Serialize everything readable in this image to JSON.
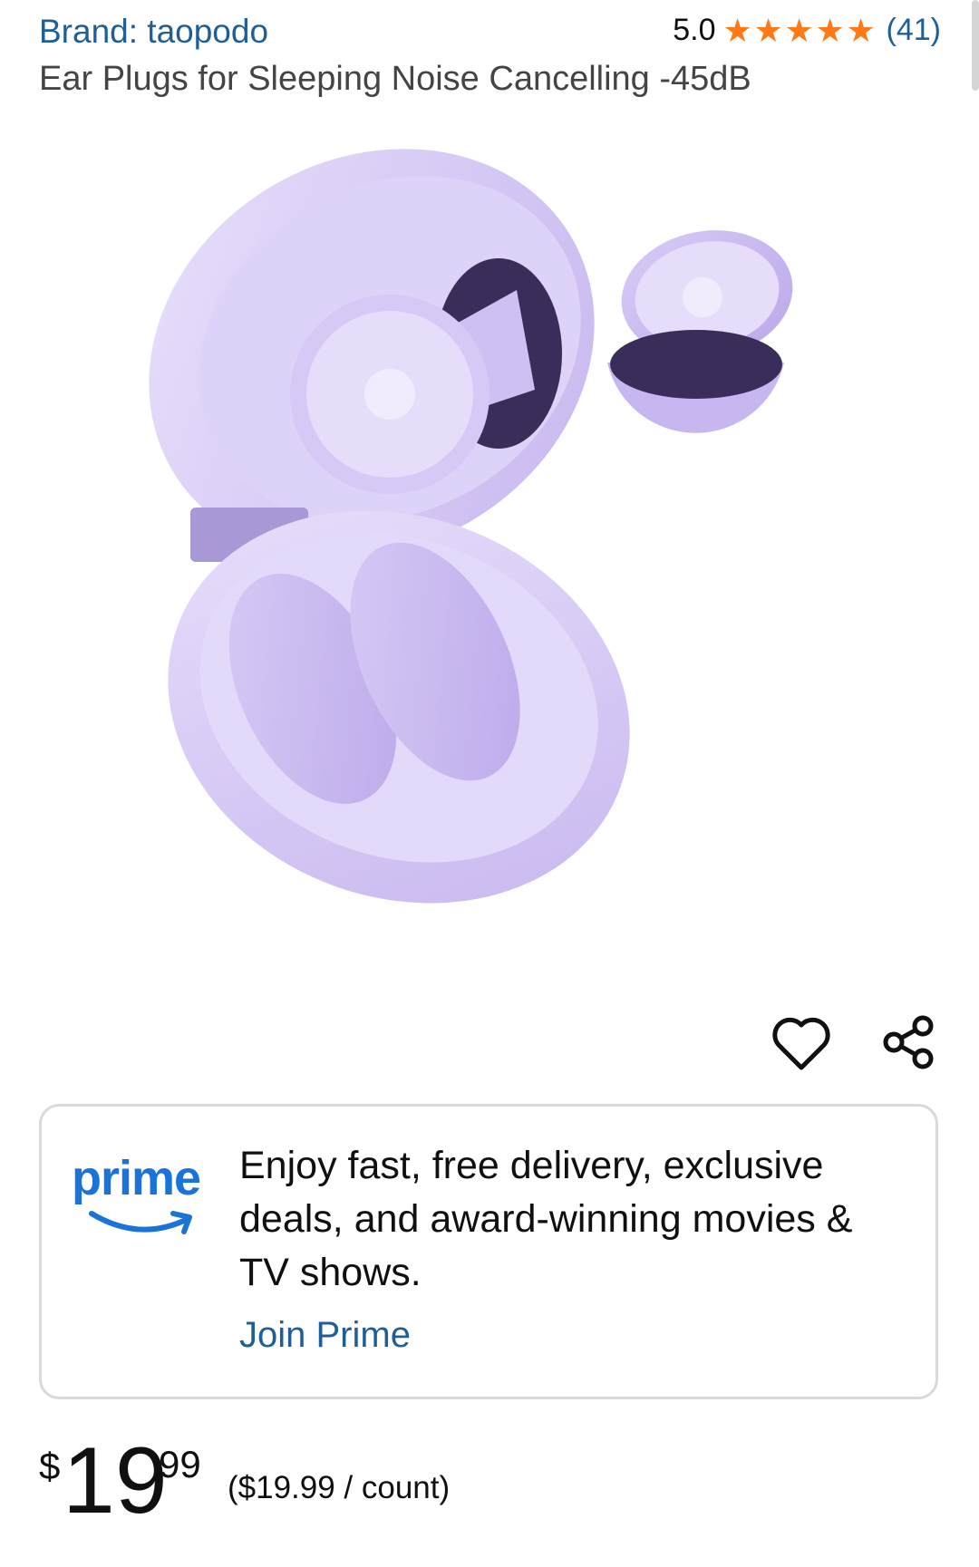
{
  "product": {
    "brand_label": "Brand: taopodo",
    "title": "Ear Plugs for Sleeping Noise Cancelling -45dB",
    "rating_value": "5.0",
    "rating_stars": 5,
    "review_count": "(41)",
    "image_description": "purple-earplugs-with-case"
  },
  "actions": {
    "favorite_icon": "heart-icon",
    "share_icon": "share-icon"
  },
  "prime": {
    "logo_text": "prime",
    "promo_text": "Enjoy fast, free delivery, exclusive deals, and award-winning movies & TV shows.",
    "join_label": "Join Prime"
  },
  "price": {
    "symbol": "$",
    "whole": "19",
    "fraction": "99",
    "unit_price": "($19.99 / count)"
  },
  "colors": {
    "link": "#1f5f99",
    "star": "#ff7a16",
    "prime_blue": "#1a73d9"
  }
}
